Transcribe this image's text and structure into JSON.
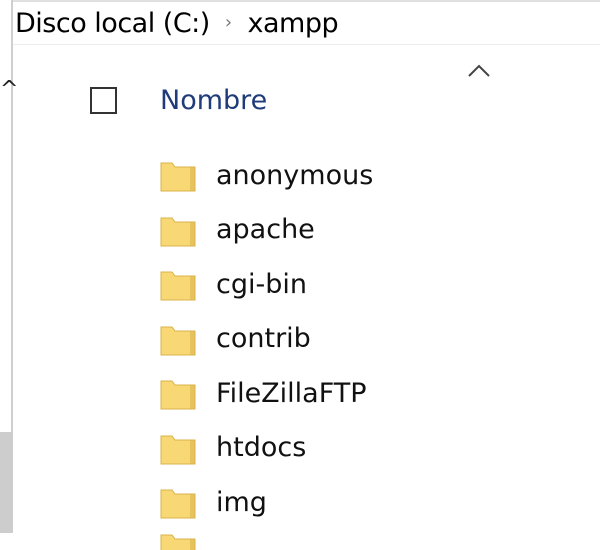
{
  "breadcrumb": {
    "items": [
      "Disco local (C:)",
      "xampp"
    ],
    "separator": "›"
  },
  "column_header": {
    "name_label": "Nombre",
    "sort_direction": "ascending"
  },
  "nav_pane": {
    "scroll_up_glyph": "^"
  },
  "files": [
    {
      "name": "anonymous",
      "type": "folder"
    },
    {
      "name": "apache",
      "type": "folder"
    },
    {
      "name": "cgi-bin",
      "type": "folder"
    },
    {
      "name": "contrib",
      "type": "folder"
    },
    {
      "name": "FileZillaFTP",
      "type": "folder"
    },
    {
      "name": "htdocs",
      "type": "folder"
    },
    {
      "name": "img",
      "type": "folder"
    }
  ],
  "colors": {
    "folder_fill": "#f8d775",
    "folder_edge": "#d9b34a",
    "header_text": "#1f3b7a"
  }
}
